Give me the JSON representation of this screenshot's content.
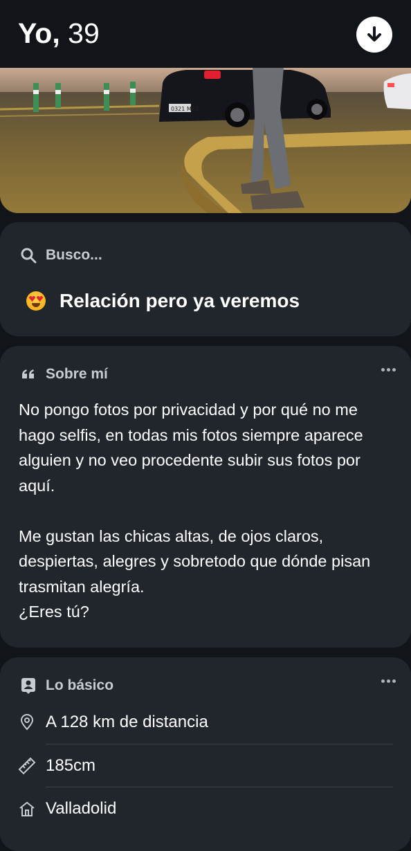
{
  "header": {
    "name": "Yo,",
    "age": "39",
    "download_icon": "arrow-down-circle-icon"
  },
  "photo": {
    "plate": "0321 MKZ",
    "description_colors": [
      "#2a2622",
      "#8a7538"
    ]
  },
  "looking_for": {
    "title": "Busco...",
    "icon": "search-icon",
    "emoji": "heart-eyes-emoji-icon",
    "value": "Relación pero ya veremos"
  },
  "about": {
    "title": "Sobre mí",
    "icon": "quote-icon",
    "paragraphs": [
      "No pongo fotos por privacidad y por qué no me hago selfis, en todas mis fotos siempre aparece alguien y no veo procedente subir sus fotos por aquí.",
      "Me gustan las chicas altas, de ojos claros, despiertas, alegres y sobretodo que dónde pisan trasmitan alegría.\n¿Eres tú?"
    ]
  },
  "basics": {
    "title": "Lo básico",
    "icon": "id-badge-icon",
    "items": [
      {
        "icon": "location-pin-icon",
        "label": "A 128 km de distancia"
      },
      {
        "icon": "ruler-icon",
        "label": "185cm"
      },
      {
        "icon": "home-icon",
        "label": "Valladolid"
      }
    ]
  },
  "colors": {
    "background": "#111418",
    "card": "#21252c",
    "muted_text": "#c8cbd1"
  }
}
